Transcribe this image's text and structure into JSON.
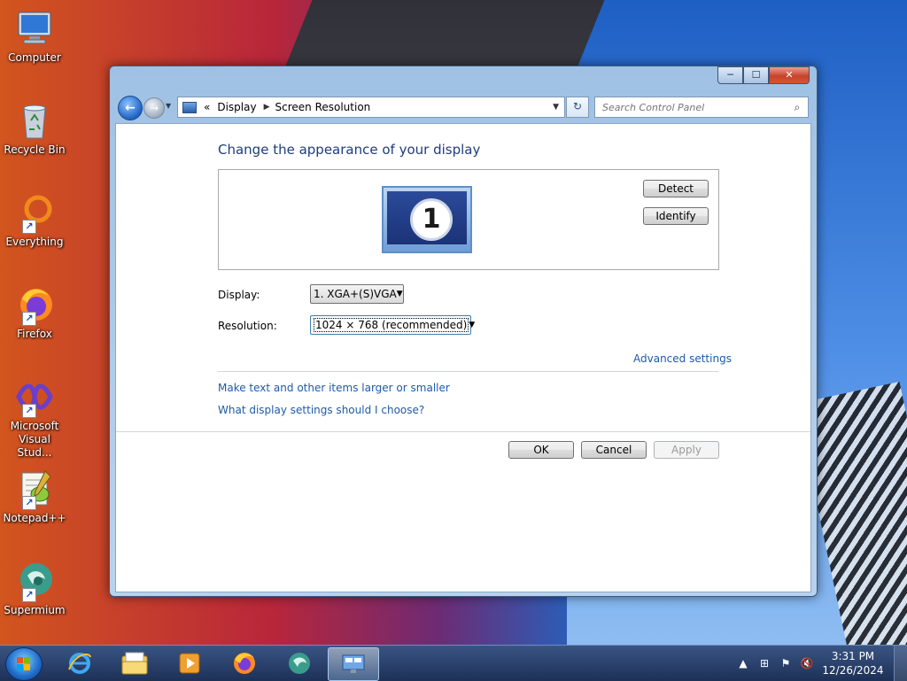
{
  "desktop": {
    "icons": [
      {
        "label": "Computer"
      },
      {
        "label": "Recycle Bin"
      },
      {
        "label": "Everything"
      },
      {
        "label": "Firefox"
      },
      {
        "label": "Microsoft Visual Stud..."
      },
      {
        "label": "Notepad++"
      },
      {
        "label": "Supermium"
      }
    ]
  },
  "window": {
    "controls": {
      "minimize": "─",
      "maximize": "☐",
      "close": "✕"
    },
    "address": {
      "prefix": "«",
      "crumbs": [
        "Display",
        "Screen Resolution"
      ]
    },
    "search": {
      "placeholder": "Search Control Panel"
    },
    "content": {
      "title": "Change the appearance of your display",
      "monitor_number": "1",
      "detect_button": "Detect",
      "identify_button": "Identify",
      "display_label": "Display:",
      "display_value": "1. XGA+(S)VGA",
      "resolution_label": "Resolution:",
      "resolution_value": "1024 × 768 (recommended)",
      "advanced_link": "Advanced settings",
      "link_text_size": "Make text and other items larger or smaller",
      "link_which_settings": "What display settings should I choose?",
      "ok_button": "OK",
      "cancel_button": "Cancel",
      "apply_button": "Apply"
    }
  },
  "taskbar": {
    "time": "3:31 PM",
    "date": "12/26/2024"
  },
  "colors": {
    "title_blue": "#1e3d7b",
    "link_blue": "#1e5aa8"
  }
}
